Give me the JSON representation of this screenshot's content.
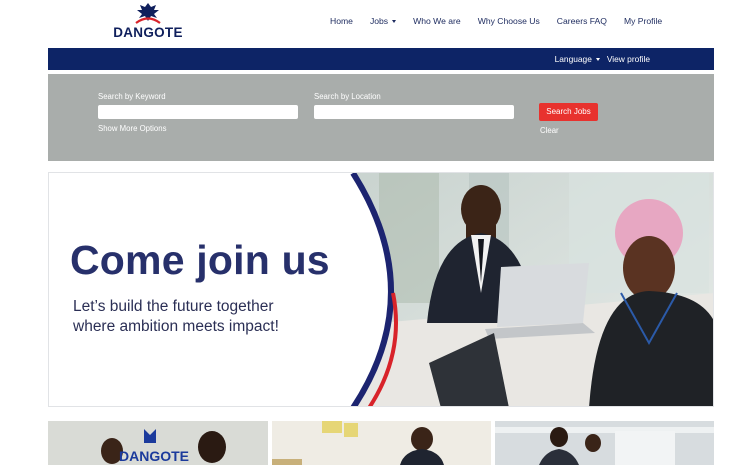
{
  "brand": {
    "name": "DANGOTE",
    "color_primary": "#0d2466",
    "color_accent": "#e8322e"
  },
  "nav": {
    "items": [
      {
        "label": "Home"
      },
      {
        "label": "Jobs",
        "has_dropdown": true
      },
      {
        "label": "Who We are"
      },
      {
        "label": "Why Choose Us"
      },
      {
        "label": "Careers FAQ"
      },
      {
        "label": "My Profile"
      }
    ]
  },
  "utility_bar": {
    "language_label": "Language",
    "view_profile_label": "View profile"
  },
  "search": {
    "keyword_label": "Search by Keyword",
    "keyword_value": "",
    "location_label": "Search by Location",
    "location_value": "",
    "button_label": "Search Jobs",
    "more_options_label": "Show More Options",
    "clear_label": "Clear"
  },
  "hero": {
    "title": "Come join us",
    "subtitle_line1": "Let’s build the future together",
    "subtitle_line2": "where ambition meets impact!"
  },
  "thumbnails": [
    {
      "icon": "team-photo-logo"
    },
    {
      "icon": "office-photo"
    },
    {
      "icon": "meeting-photo"
    }
  ]
}
